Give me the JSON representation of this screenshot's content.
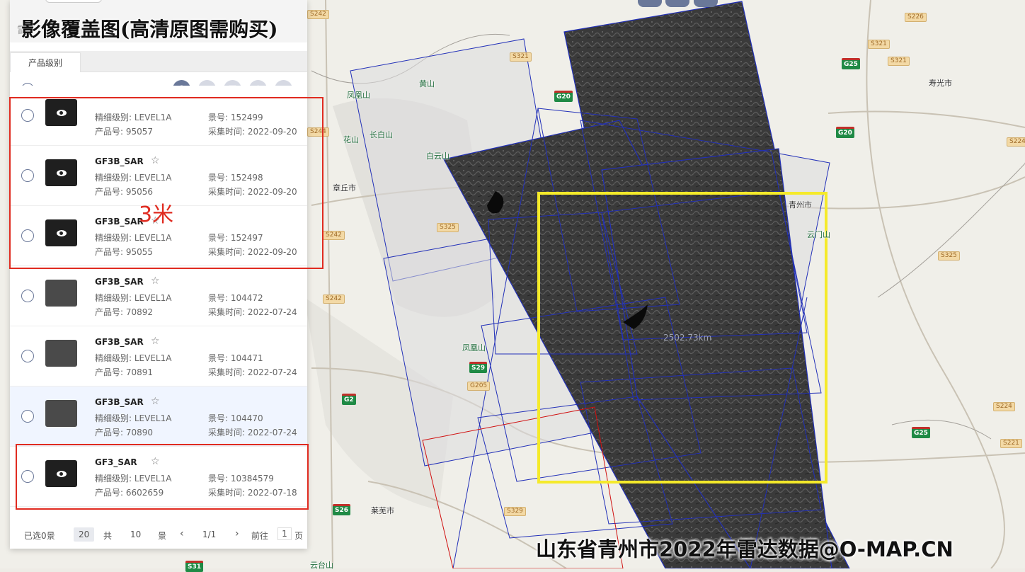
{
  "overlay_title": "影像覆盖图(高清原图需购买)",
  "watermark": "山东省青州市2022年雷达数据@O-MAP.CN",
  "resolution_note": "3米",
  "area_label": "2502.73km",
  "panel": {
    "header_partial": "雷",
    "tab_label": "产品级别",
    "toolbar_icons": [
      "eye-icon",
      "basket-icon",
      "cart-icon",
      "star-icon",
      "more-icon"
    ],
    "labels": {
      "level": "精细级别: ",
      "product": "产品号: ",
      "scene": "景号: ",
      "date": "采集时间: "
    },
    "rows": [
      {
        "name": "",
        "level": "LEVEL1A",
        "product": "95057",
        "scene": "152499",
        "date": "2022-09-20",
        "thumb": "dark",
        "eye": true
      },
      {
        "name": "GF3B_SAR",
        "level": "LEVEL1A",
        "product": "95056",
        "scene": "152498",
        "date": "2022-09-20",
        "thumb": "dark",
        "eye": true
      },
      {
        "name": "GF3B_SAR",
        "level": "LEVEL1A",
        "product": "95055",
        "scene": "152497",
        "date": "2022-09-20",
        "thumb": "dark",
        "eye": true
      },
      {
        "name": "GF3B_SAR",
        "level": "LEVEL1A",
        "product": "70892",
        "scene": "104472",
        "date": "2022-07-24",
        "thumb": "gray",
        "eye": false
      },
      {
        "name": "GF3B_SAR",
        "level": "LEVEL1A",
        "product": "70891",
        "scene": "104471",
        "date": "2022-07-24",
        "thumb": "gray",
        "eye": false
      },
      {
        "name": "GF3B_SAR",
        "level": "LEVEL1A",
        "product": "70890",
        "scene": "104470",
        "date": "2022-07-24",
        "thumb": "gray",
        "eye": false
      },
      {
        "name": "GF3_SAR",
        "level": "LEVEL1A",
        "product": "6602659",
        "scene": "10384579",
        "date": "2022-07-18",
        "thumb": "dark",
        "eye": true
      }
    ],
    "pager": {
      "selected": "已选0景",
      "page_size": "20",
      "total_prefix": "共",
      "total": "10",
      "total_suffix": "景",
      "prev": "‹",
      "page": "1/1",
      "next": "›",
      "goto_label": "前往",
      "goto_value": "1",
      "page_suffix": "页"
    }
  },
  "map": {
    "places": [
      "黄山",
      "凤凰山",
      "长白山",
      "花山",
      "白云山",
      "章丘市",
      "青州市",
      "云门山",
      "寿光市",
      "凤凰山",
      "莱芜市",
      "云台山"
    ],
    "highways": [
      "G20",
      "G20",
      "G25",
      "G25",
      "S29",
      "G2",
      "S26",
      "G205",
      "S31"
    ],
    "provincial": [
      "S242",
      "S321",
      "S244",
      "S242",
      "S325",
      "S242",
      "S226",
      "S321",
      "S224",
      "S325",
      "S224",
      "S221",
      "S329",
      "S321"
    ]
  },
  "colors": {
    "footprint_blue": "#2230b8",
    "footprint_red": "#d01010",
    "aoi_yellow": "#f5ea2a",
    "annotation_red": "#e02b20",
    "panel_accent": "#6a7899"
  }
}
